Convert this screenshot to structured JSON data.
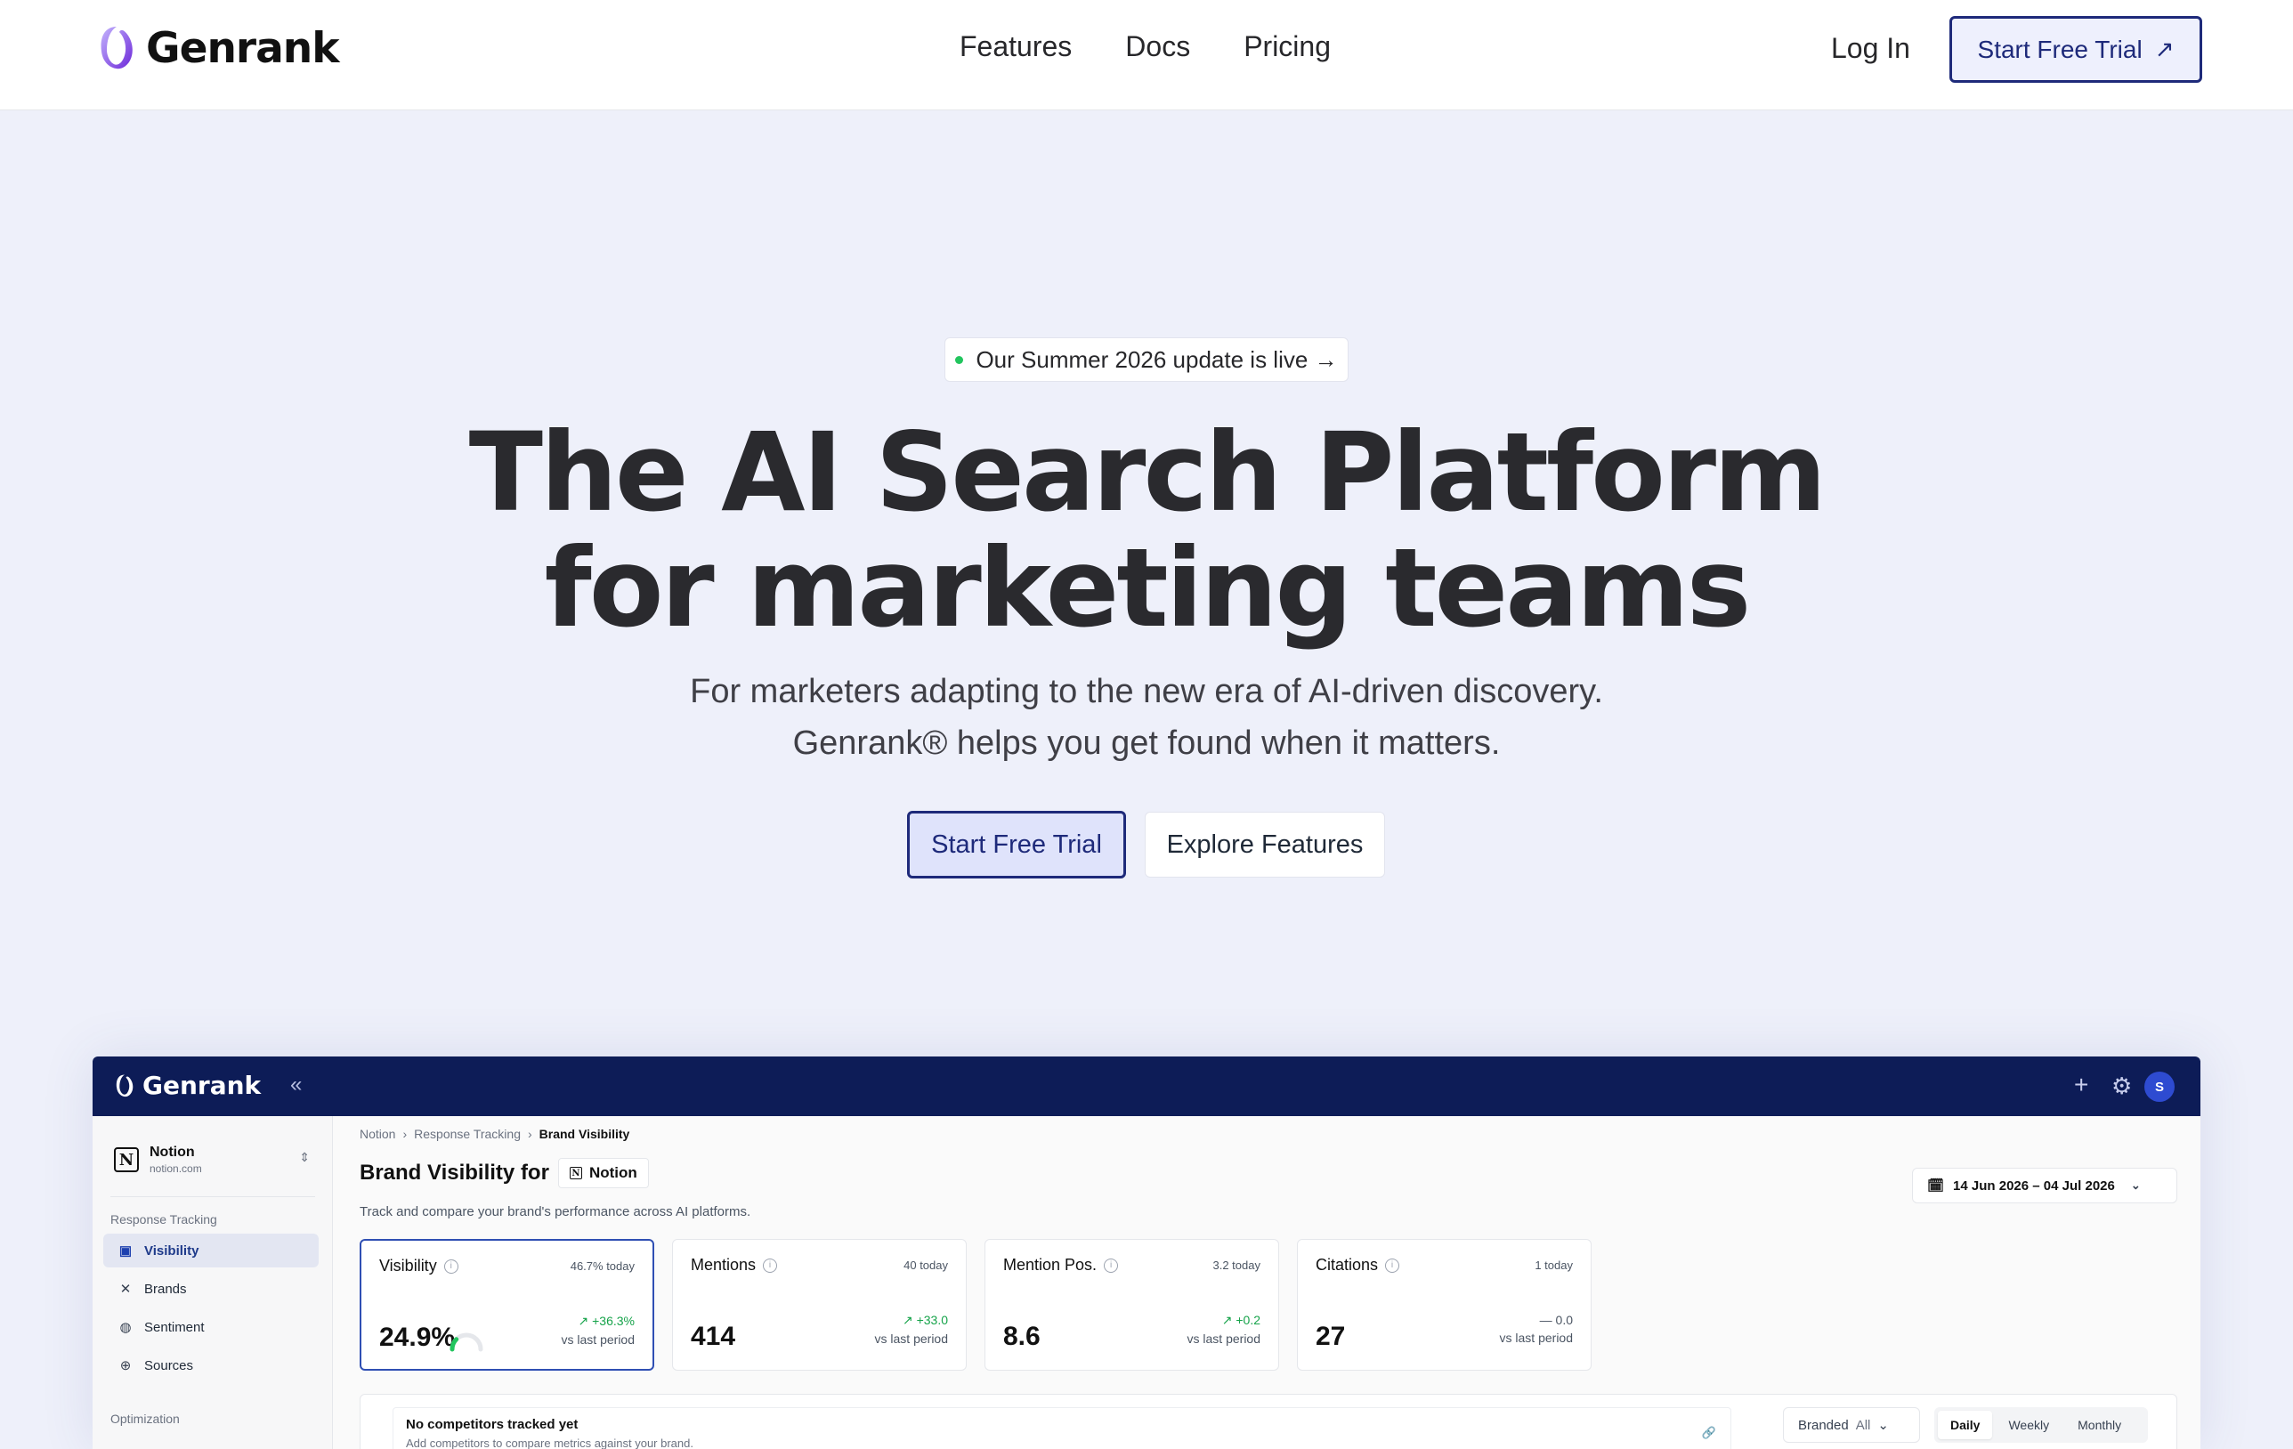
{
  "nav": {
    "brand": "Genrank",
    "links": [
      "Features",
      "Docs",
      "Pricing"
    ],
    "login": "Log In",
    "cta": "Start Free Trial",
    "cta_icon": "arrow-up-right-icon"
  },
  "hero": {
    "badge": "Our Summer 2026 update is live →",
    "title_line1": "The AI Search Platform",
    "title_line2": "for marketing teams",
    "sub_line1": "For marketers adapting to the new era of AI-driven discovery.",
    "sub_line2": "Genrank® helps you get found when it matters.",
    "primary_button": "Start Free Trial",
    "secondary_button": "Explore Features"
  },
  "app": {
    "brand": "Genrank",
    "collapse_glyph": "«",
    "plus_glyph": "+",
    "gear_glyph": "⚙",
    "avatar": "S",
    "workspace": {
      "name": "Notion",
      "url": "notion.com",
      "icon": "N"
    },
    "sidebar": {
      "section1": "Response Tracking",
      "items": [
        {
          "label": "Visibility",
          "icon": "monitor-icon",
          "glyph": "▣",
          "active": true
        },
        {
          "label": "Brands",
          "icon": "brands-icon",
          "glyph": "✕",
          "active": false
        },
        {
          "label": "Sentiment",
          "icon": "sentiment-icon",
          "glyph": "◍",
          "active": false
        },
        {
          "label": "Sources",
          "icon": "globe-icon",
          "glyph": "⊕",
          "active": false
        }
      ],
      "section2": "Optimization"
    },
    "breadcrumb": [
      "Notion",
      "Response Tracking",
      "Brand Visibility"
    ],
    "page_title": "Brand Visibility for",
    "page_chip": "Notion",
    "page_desc": "Track and compare your brand's performance across AI platforms.",
    "date_range": "14 Jun 2026 – 04 Jul 2026",
    "cards": [
      {
        "label": "Visibility",
        "today": "46.7% today",
        "value": "24.9%",
        "delta": "↗ +36.3%",
        "vs": "vs last period"
      },
      {
        "label": "Mentions",
        "today": "40 today",
        "value": "414",
        "delta": "↗ +33.0",
        "vs": "vs last period"
      },
      {
        "label": "Mention Pos.",
        "today": "3.2 today",
        "value": "8.6",
        "delta": "↗ +0.2",
        "vs": "vs last period"
      },
      {
        "label": "Citations",
        "today": "1 today",
        "value": "27",
        "delta": "— 0.0",
        "vs": "vs last period"
      }
    ],
    "empty": {
      "title": "No competitors tracked yet",
      "desc": "Add competitors to compare metrics against your brand.",
      "link_glyph": "🔗"
    },
    "filter": {
      "label": "Branded",
      "value": "All"
    },
    "granularity": [
      "Daily",
      "Weekly",
      "Monthly"
    ],
    "visibility_gauge_fraction": 0.249
  },
  "colors": {
    "accent": "#1e2a7a",
    "app_header": "#0d1c57",
    "positive": "#16a34a",
    "logo_purple": "#8b5cf6"
  }
}
